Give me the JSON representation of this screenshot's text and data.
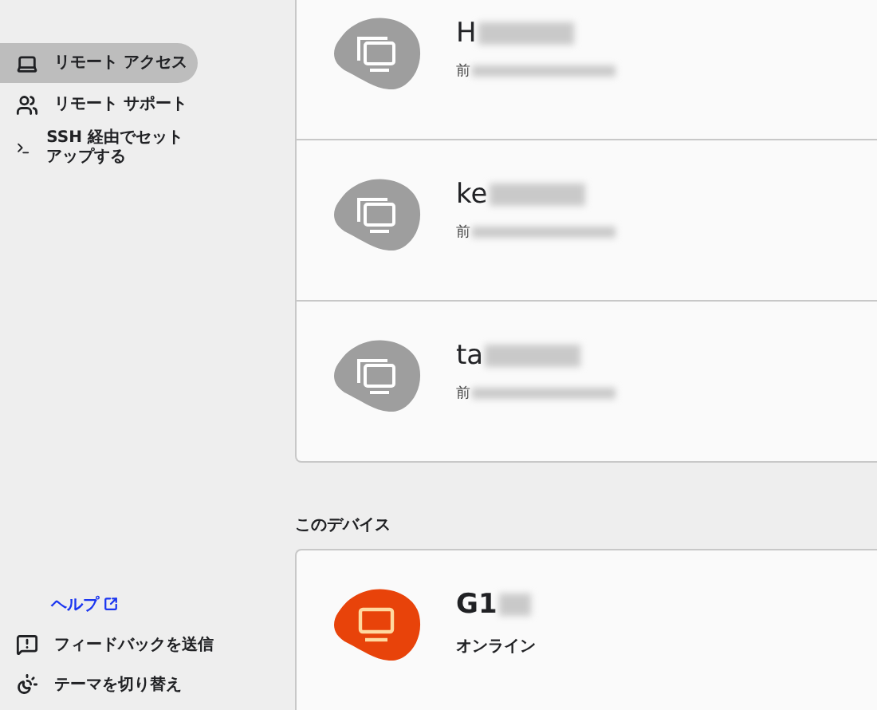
{
  "sidebar": {
    "items": [
      {
        "kind": "laptop",
        "label": "リモート アクセス",
        "selected": true
      },
      {
        "kind": "people",
        "label": "リモート サポート",
        "selected": false
      },
      {
        "kind": "terminal",
        "label": "SSH 経由でセットアップする",
        "selected": false
      }
    ],
    "footer": [
      {
        "kind": "link",
        "label": "ヘルプ"
      },
      {
        "kind": "feedback",
        "label": "フィードバックを送信"
      },
      {
        "kind": "theme",
        "label": "テーマを切り替え"
      }
    ]
  },
  "devices": [
    {
      "name": "H",
      "detail": "前",
      "online": false
    },
    {
      "name": "ke",
      "detail": "前",
      "online": false
    },
    {
      "name": "ta",
      "detail": "前",
      "online": false
    }
  ],
  "this_device": {
    "heading": "このデバイス",
    "name": "G1",
    "status": "オンライン",
    "online": true
  }
}
